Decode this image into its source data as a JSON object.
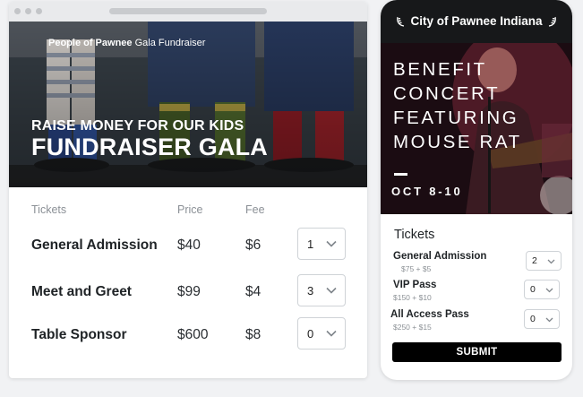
{
  "desktop": {
    "brand_bold": "People of Pawnee",
    "brand_rest": " Gala Fundraiser",
    "hero_subtitle": "RAISE MONEY FOR OUR KIDS",
    "hero_title": "FUNDRAISER GALA",
    "columns": {
      "tickets": "Tickets",
      "price": "Price",
      "fee": "Fee"
    },
    "rows": [
      {
        "name": "General Admission",
        "price": "$40",
        "fee": "$6",
        "qty": "1"
      },
      {
        "name": "Meet and Greet",
        "price": "$99",
        "fee": "$4",
        "qty": "3"
      },
      {
        "name": "Table Sponsor",
        "price": "$600",
        "fee": "$8",
        "qty": "0"
      }
    ]
  },
  "mobile": {
    "city_title": "City of Pawnee Indiana",
    "concert_title": "BENEFIT\nCONCERT\nFEATURING\nMOUSE RAT",
    "dates": "OCT 8-10",
    "tickets_heading": "Tickets",
    "rows": [
      {
        "name": "General Admission",
        "price": "$75 + $5",
        "qty": "2"
      },
      {
        "name": "VIP Pass",
        "price": "$150 + $10",
        "qty": "0"
      },
      {
        "name": "All Access Pass",
        "price": "$250 + $15",
        "qty": "0"
      }
    ],
    "submit_label": "SUBMIT"
  },
  "colors": {
    "page_bg": "#f1f2f4",
    "header_bg": "#17181a",
    "button_bg": "#000000"
  },
  "icons": [
    "chevron-down-icon",
    "wreath-left-icon",
    "wreath-right-icon"
  ]
}
